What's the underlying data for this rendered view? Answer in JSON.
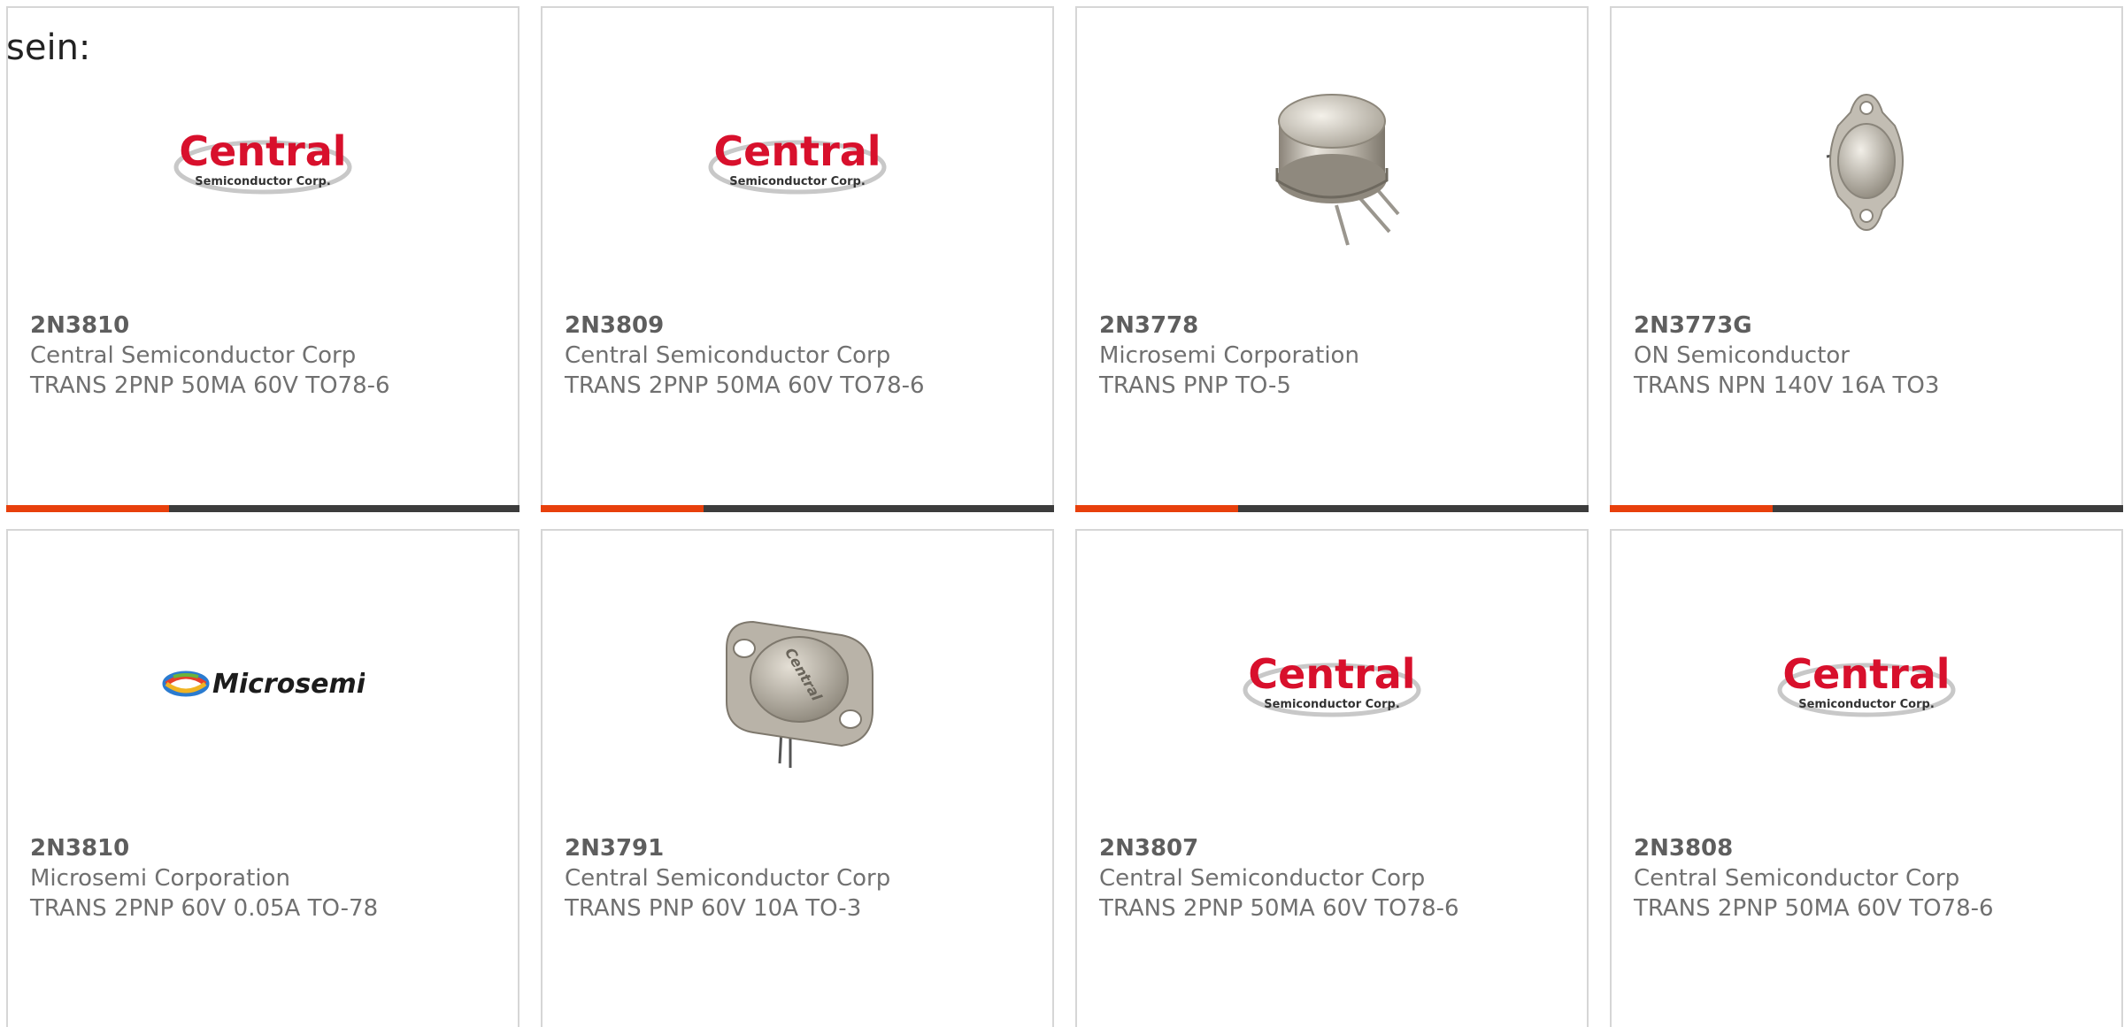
{
  "intro_text": "sein:",
  "colors": {
    "accent": "#e8400c",
    "bar": "#3c3c3c",
    "central_red": "#d8102c"
  },
  "products": [
    {
      "part_number": "2N3810",
      "manufacturer": "Central Semiconductor Corp",
      "description": "TRANS 2PNP 50MA 60V TO78-6",
      "image": "central-semiconductor-logo",
      "logo_main": "Central",
      "logo_sub": "Semiconductor Corp."
    },
    {
      "part_number": "2N3809",
      "manufacturer": "Central Semiconductor Corp",
      "description": "TRANS 2PNP 50MA 60V TO78-6",
      "image": "central-semiconductor-logo",
      "logo_main": "Central",
      "logo_sub": "Semiconductor Corp."
    },
    {
      "part_number": "2N3778",
      "manufacturer": "Microsemi Corporation",
      "description": "TRANS PNP TO-5",
      "image": "to5-can-transistor-photo"
    },
    {
      "part_number": "2N3773G",
      "manufacturer": "ON Semiconductor",
      "description": "TRANS NPN 140V 16A TO3",
      "image": "to3-transistor-photo"
    },
    {
      "part_number": "2N3810",
      "manufacturer": "Microsemi Corporation",
      "description": "TRANS 2PNP 60V 0.05A TO-78",
      "image": "microsemi-logo",
      "logo_main": "Microsemi"
    },
    {
      "part_number": "2N3791",
      "manufacturer": "Central Semiconductor Corp",
      "description": "TRANS PNP 60V 10A TO-3",
      "image": "to3-central-transistor-photo",
      "logo_main": "Central"
    },
    {
      "part_number": "2N3807",
      "manufacturer": "Central Semiconductor Corp",
      "description": "TRANS 2PNP 50MA 60V TO78-6",
      "image": "central-semiconductor-logo",
      "logo_main": "Central",
      "logo_sub": "Semiconductor Corp."
    },
    {
      "part_number": "2N3808",
      "manufacturer": "Central Semiconductor Corp",
      "description": "TRANS 2PNP 50MA 60V TO78-6",
      "image": "central-semiconductor-logo",
      "logo_main": "Central",
      "logo_sub": "Semiconductor Corp."
    }
  ]
}
